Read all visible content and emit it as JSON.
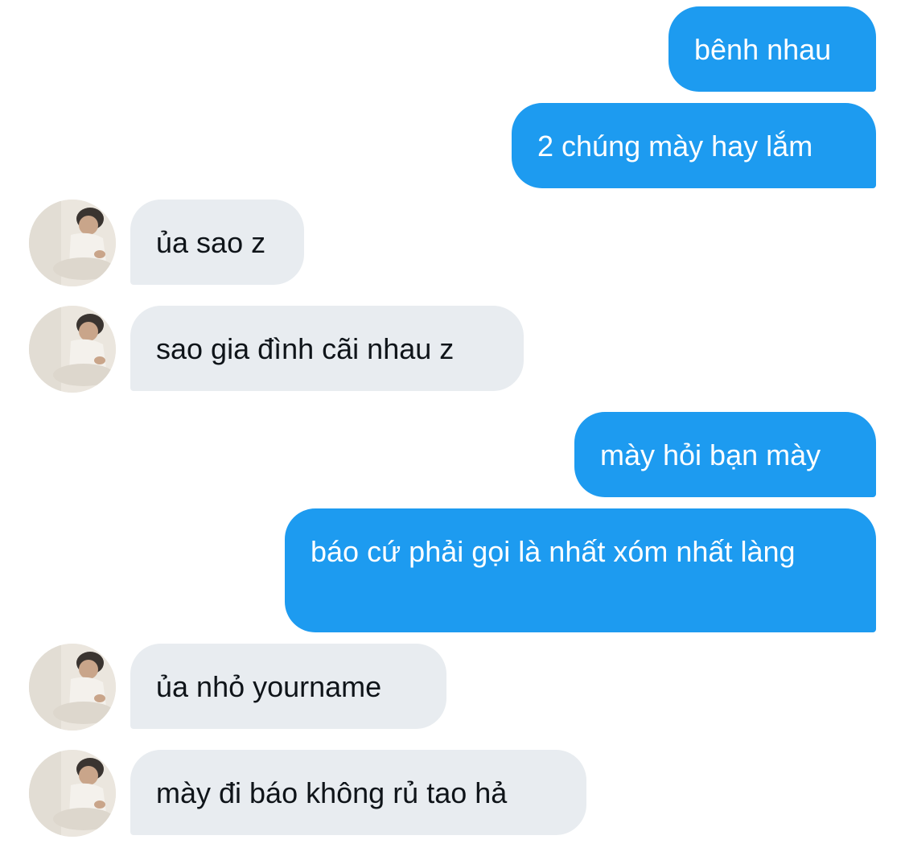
{
  "conversation": {
    "messages": [
      {
        "side": "sent",
        "text": "bênh nhau"
      },
      {
        "side": "sent",
        "text": "2 chúng mày hay lắm"
      },
      {
        "side": "received",
        "text": "ủa sao z",
        "avatar": "user-photo-avatar"
      },
      {
        "side": "received",
        "text": "sao gia đình cãi nhau z",
        "avatar": "user-photo-avatar"
      },
      {
        "side": "sent",
        "text": "mày hỏi bạn mày"
      },
      {
        "side": "sent",
        "text": "báo cứ phải gọi là nhất xóm nhất làng"
      },
      {
        "side": "received",
        "text": "ủa nhỏ yourname",
        "avatar": "user-photo-avatar"
      },
      {
        "side": "received",
        "text": "mày đi báo không rủ tao hả",
        "avatar": "user-photo-avatar"
      }
    ]
  },
  "colors": {
    "sent_bubble": "#1d9bf0",
    "received_bubble": "#e8ecf0",
    "received_text": "#0f1419",
    "background": "#ffffff"
  }
}
